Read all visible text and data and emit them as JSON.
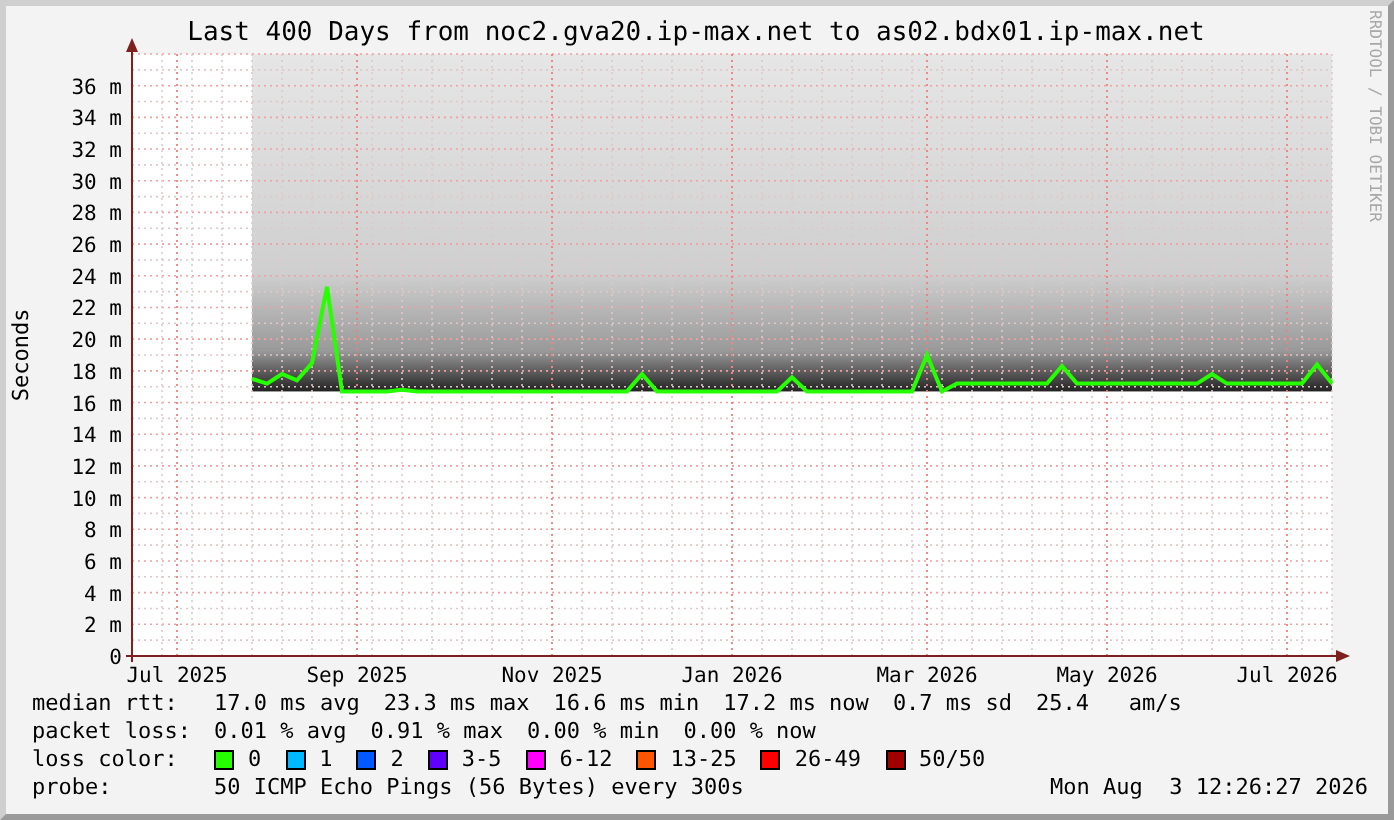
{
  "chart": {
    "credit": "RRDTOOL / TOBI OETIKER",
    "chart_data": {
      "type": "line",
      "title": "Last 400 Days from noc2.gva20.ip-max.net to as02.bdx01.ip-max.net",
      "ylabel": "Seconds",
      "categories": [
        null,
        null,
        null,
        "Jul 2025",
        null,
        null,
        null,
        null,
        null,
        null,
        null,
        null,
        null,
        null,
        null,
        "Sep 2025",
        null,
        null,
        null,
        null,
        null,
        null,
        null,
        null,
        null,
        null,
        null,
        null,
        "Nov 2025",
        null,
        null,
        null,
        null,
        null,
        null,
        null,
        null,
        null,
        null,
        null,
        "Jan 2026",
        null,
        null,
        null,
        null,
        null,
        null,
        null,
        null,
        null,
        null,
        null,
        null,
        "Mar 2026",
        null,
        null,
        null,
        null,
        null,
        null,
        null,
        null,
        null,
        null,
        null,
        "May 2026",
        null,
        null,
        null,
        null,
        null,
        null,
        null,
        null,
        null,
        null,
        null,
        "Jul 2026",
        null,
        null,
        null
      ],
      "series": [
        {
          "values": [
            null,
            null,
            null,
            null,
            null,
            null,
            null,
            null,
            17.5,
            17.2,
            17.8,
            17.4,
            18.5,
            23.3,
            16.7,
            16.7,
            16.7,
            16.7,
            16.8,
            16.7,
            16.7,
            16.7,
            16.7,
            16.7,
            16.7,
            16.7,
            16.7,
            16.7,
            16.7,
            16.7,
            16.7,
            16.7,
            16.7,
            16.7,
            17.8,
            16.7,
            16.7,
            16.7,
            16.7,
            16.7,
            16.7,
            16.7,
            16.7,
            16.7,
            17.6,
            16.7,
            16.7,
            16.7,
            16.7,
            16.7,
            16.7,
            16.7,
            16.7,
            19.0,
            16.7,
            17.2,
            17.2,
            17.2,
            17.2,
            17.2,
            17.2,
            17.2,
            18.3,
            17.2,
            17.2,
            17.2,
            17.2,
            17.2,
            17.2,
            17.2,
            17.2,
            17.2,
            17.8,
            17.2,
            17.2,
            17.2,
            17.2,
            17.2,
            17.2,
            18.4,
            17.2
          ]
        }
      ],
      "ylim": [
        0,
        38
      ],
      "grid": true,
      "yticks": [
        {
          "value": 0,
          "label": "0"
        },
        {
          "value": 2,
          "label": "2 m"
        },
        {
          "value": 4,
          "label": "4 m"
        },
        {
          "value": 6,
          "label": "6 m"
        },
        {
          "value": 8,
          "label": "8 m"
        },
        {
          "value": 10,
          "label": "10 m"
        },
        {
          "value": 12,
          "label": "12 m"
        },
        {
          "value": 14,
          "label": "14 m"
        },
        {
          "value": 16,
          "label": "16 m"
        },
        {
          "value": 18,
          "label": "18 m"
        },
        {
          "value": 20,
          "label": "20 m"
        },
        {
          "value": 22,
          "label": "22 m"
        },
        {
          "value": 24,
          "label": "24 m"
        },
        {
          "value": 26,
          "label": "26 m"
        },
        {
          "value": 28,
          "label": "28 m"
        },
        {
          "value": 30,
          "label": "30 m"
        },
        {
          "value": 32,
          "label": "32 m"
        },
        {
          "value": 34,
          "label": "34 m"
        },
        {
          "value": 36,
          "label": "36 m"
        }
      ]
    }
  },
  "legend": {
    "median_rtt": {
      "label": "median rtt:",
      "values": [
        "17.0 ms avg",
        "23.3 ms max",
        "16.6 ms min",
        "17.2 ms now",
        "0.7 ms sd",
        "25.4   am/s"
      ]
    },
    "packet_loss": {
      "label": "packet loss:",
      "values": [
        "0.01 % avg",
        "0.91 % max",
        "0.00 % min",
        "0.00 % now"
      ]
    },
    "loss_color": {
      "label": "loss color:",
      "items": [
        {
          "label": "0",
          "color": "#26ff00"
        },
        {
          "label": "1",
          "color": "#00b8ff"
        },
        {
          "label": "2",
          "color": "#0059ff"
        },
        {
          "label": "3-5",
          "color": "#5e00ff"
        },
        {
          "label": "6-12",
          "color": "#ff00ff"
        },
        {
          "label": "13-25",
          "color": "#ff5500"
        },
        {
          "label": "26-49",
          "color": "#ff0000"
        },
        {
          "label": "50/50",
          "color": "#a10000"
        }
      ]
    },
    "probe": {
      "label": "probe:",
      "text": "50 ICMP Echo Pings (56 Bytes) every 300s",
      "timestamp": "Mon Aug  3 12:26:27 2026"
    }
  }
}
